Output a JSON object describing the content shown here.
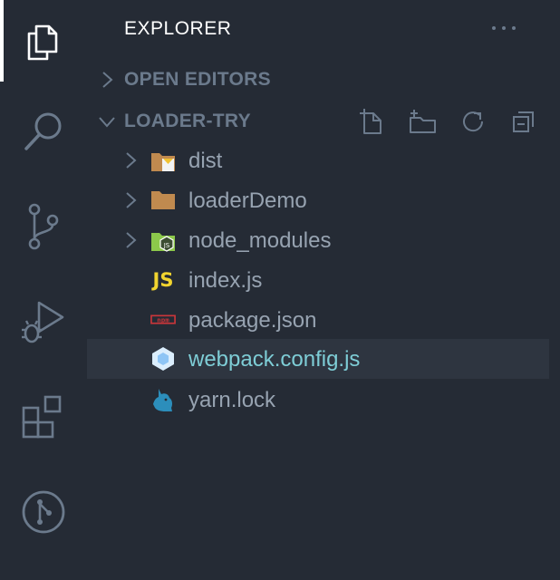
{
  "explorer": {
    "title": "EXPLORER",
    "more_label": "···"
  },
  "sections": {
    "open_editors": {
      "label": "OPEN EDITORS",
      "expanded": false
    },
    "project": {
      "label": "LOADER-TRY",
      "expanded": true
    }
  },
  "tree": [
    {
      "label": "dist",
      "type": "folder",
      "icon": "dist-folder-icon"
    },
    {
      "label": "loaderDemo",
      "type": "folder",
      "icon": "folder-icon"
    },
    {
      "label": "node_modules",
      "type": "folder",
      "icon": "node-folder-icon"
    },
    {
      "label": "index.js",
      "type": "file",
      "icon": "js-file-icon",
      "icon_text": "JS"
    },
    {
      "label": "package.json",
      "type": "file",
      "icon": "npm-file-icon",
      "icon_text": "npm"
    },
    {
      "label": "webpack.config.js",
      "type": "file",
      "icon": "webpack-file-icon",
      "selected": true
    },
    {
      "label": "yarn.lock",
      "type": "file",
      "icon": "yarn-file-icon"
    }
  ],
  "colors": {
    "background": "#252b35",
    "selected_row": "#2e3540",
    "label": "#97a3b1",
    "selected_label": "#7ecdd6",
    "section_label": "#6b7a8c",
    "js_yellow": "#f1d42f",
    "npm_red": "#c9363a",
    "webpack_blue": "#8ec5f5",
    "yarn_blue": "#2c8ebb"
  }
}
